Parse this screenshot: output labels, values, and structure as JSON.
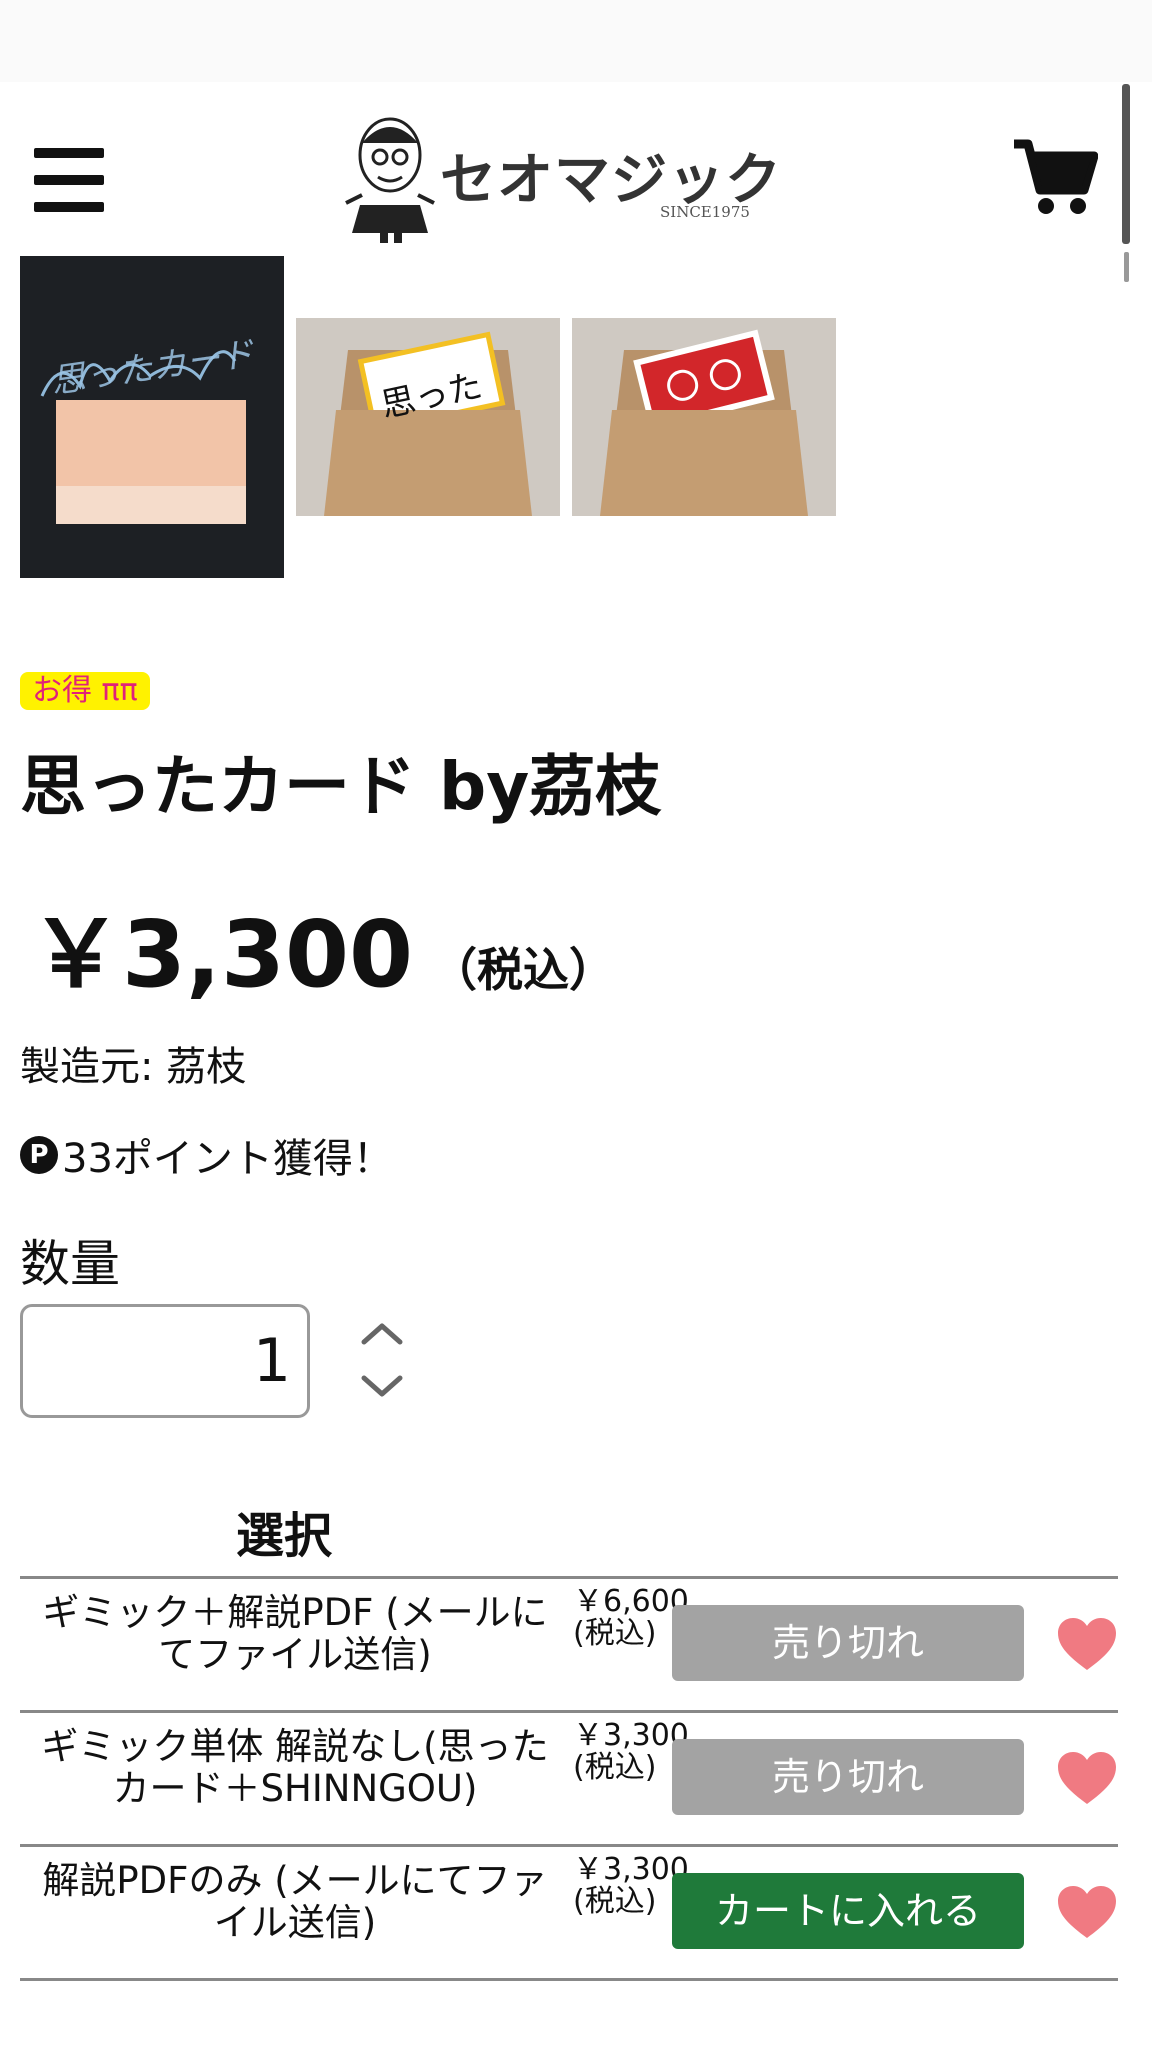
{
  "header": {
    "logo_brand": "セオマジック",
    "logo_since": "SINCE1975",
    "menu_icon": "hamburger-menu-icon",
    "cart_icon": "shopping-cart-icon"
  },
  "gallery": {
    "thumb1_text": "思ったカード",
    "thumb2_text": "思った"
  },
  "product": {
    "badge": "お得 ππ",
    "title": "思ったカード by茘枝",
    "price": "￥3,300",
    "tax_label": "（税込）",
    "maker": "製造元: 茘枝",
    "points_icon": "P",
    "points": "33ポイント獲得！"
  },
  "quantity": {
    "label": "数量",
    "value": "1"
  },
  "options": {
    "header": "選択",
    "items": [
      {
        "label": "ギミック＋解説PDF (メールにてファイル送信)",
        "price": "￥6,600",
        "tax": "(税込)",
        "button": "売り切れ",
        "available": false
      },
      {
        "label": "ギミック単体 解説なし(思ったカード＋SHINNGOU)",
        "price": "￥3,300",
        "tax": "(税込)",
        "button": "売り切れ",
        "available": false
      },
      {
        "label": "解説PDFのみ (メールにてファイル送信)",
        "price": "￥3,300",
        "tax": "(税込)",
        "button": "カートに入れる",
        "available": true
      }
    ]
  },
  "colors": {
    "soldout": "#a3a3a3",
    "add_to_cart": "#1f7a3a",
    "heart": "#f07a82",
    "badge_bg": "#fff200",
    "badge_text": "#e0227a"
  }
}
